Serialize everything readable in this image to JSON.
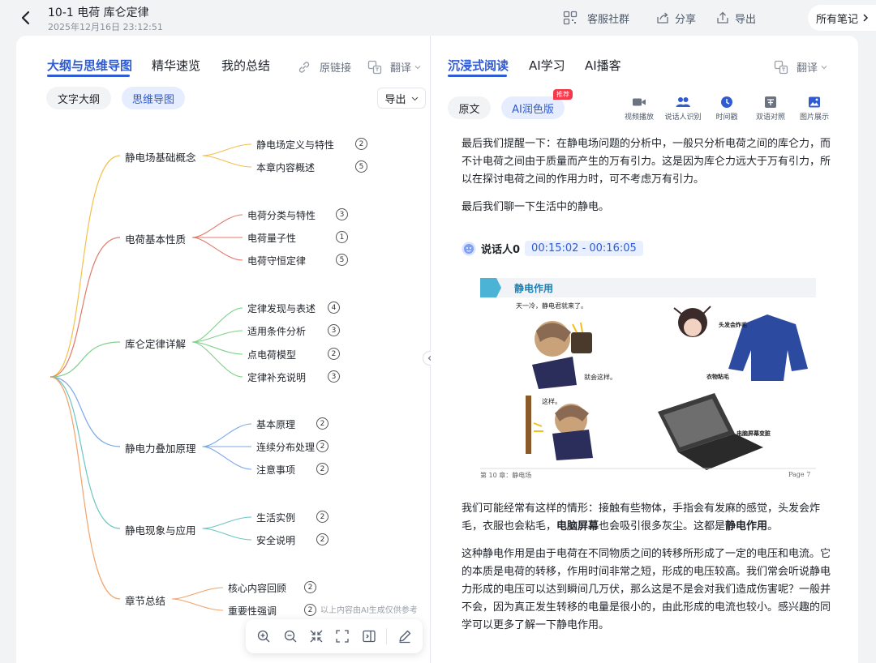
{
  "header": {
    "title": "10-1 电荷 库仑定律",
    "date": "2025年12月16日 23:12:51",
    "service_label": "客服社群",
    "share_label": "分享",
    "export_label": "导出",
    "all_notes_label": "所有笔记"
  },
  "left": {
    "tabs": [
      "大纲与思维导图",
      "精华速览",
      "我的总结"
    ],
    "original_link": "原链接",
    "translate": "翻译",
    "views": [
      "文字大纲",
      "思维导图"
    ],
    "export": "导出",
    "ai_note": "以上内容由AI生成仅供参考"
  },
  "mindmap": {
    "branches": [
      {
        "label": "静电场基础概念",
        "color": "#f2c14e",
        "children": [
          {
            "label": "静电场定义与特性",
            "count": "2"
          },
          {
            "label": "本章内容概述",
            "count": "5"
          }
        ]
      },
      {
        "label": "电荷基本性质",
        "color": "#e07a6a",
        "children": [
          {
            "label": "电荷分类与特性",
            "count": "3"
          },
          {
            "label": "电荷量子性",
            "count": "1"
          },
          {
            "label": "电荷守恒定律",
            "count": "5"
          }
        ]
      },
      {
        "label": "库仑定律详解",
        "color": "#7fd18b",
        "children": [
          {
            "label": "定律发现与表述",
            "count": "4"
          },
          {
            "label": "适用条件分析",
            "count": "3"
          },
          {
            "label": "点电荷模型",
            "count": "2"
          },
          {
            "label": "定律补充说明",
            "count": "3"
          }
        ]
      },
      {
        "label": "静电力叠加原理",
        "color": "#7aa7e8",
        "children": [
          {
            "label": "基本原理",
            "count": "2"
          },
          {
            "label": "连续分布处理",
            "count": "2"
          },
          {
            "label": "注意事项",
            "count": "2"
          }
        ]
      },
      {
        "label": "静电现象与应用",
        "color": "#6cc6c1",
        "children": [
          {
            "label": "生活实例",
            "count": "2"
          },
          {
            "label": "安全说明",
            "count": "2"
          }
        ]
      },
      {
        "label": "章节总结",
        "color": "#f0a36b",
        "children": [
          {
            "label": "核心内容回顾",
            "count": "2"
          },
          {
            "label": "重要性强调",
            "count": "2"
          }
        ]
      }
    ]
  },
  "right": {
    "tabs": [
      "沉浸式阅读",
      "AI学习",
      "AI播客"
    ],
    "translate": "翻译",
    "modes": [
      "原文",
      "AI润色版"
    ],
    "recommend_tag": "推荐",
    "tools": [
      "视频播放",
      "说话人识别",
      "时间戳",
      "双语对照",
      "图片展示"
    ],
    "para1": "最后我们提醒一下：在静电场问题的分析中，一般只分析电荷之间的库仑力，而不计电荷之间由于质量而产生的万有引力。这是因为库仑力远大于万有引力，所以在探讨电荷之间的作用力时，可不考虑万有引力。",
    "para2": "最后我们聊一下生活中的静电。",
    "speaker": "说话人0",
    "timestamp": "00:15:02 - 00:16:05",
    "para3_a": "我们可能经常有这样的情形：接触有些物体，手指会有发麻的感觉，头发会炸毛，衣服也会粘毛，",
    "para3_b": "电脑屏幕",
    "para3_c": "也会吸引很多灰尘。这都是",
    "para3_d": "静电作用",
    "para3_e": "。",
    "para4": "这种静电作用是由于电荷在不同物质之间的转移所形成了一定的电压和电流。它的本质是电荷的转移，作用时间非常之短，形成的电压较高。我们常会听说静电力形成的电压可以达到瞬间几万伏，那么这是不是会对我们造成伤害呢？一般并不会，因为真正发生转移的电量是很小的，由此形成的电流也较小。感兴趣的同学可以更多了解一下静电作用。"
  },
  "book": {
    "heading": "静电作用",
    "caption1": "天一冷，静电君就来了。",
    "caption2": "就会这样。",
    "caption3": "头发会炸毛",
    "caption4": "衣物粘毛",
    "caption5": "这样。",
    "caption6": "电脑屏幕变脏",
    "footer_left": "第 10 章：静电场",
    "footer_right": "Page 7"
  }
}
